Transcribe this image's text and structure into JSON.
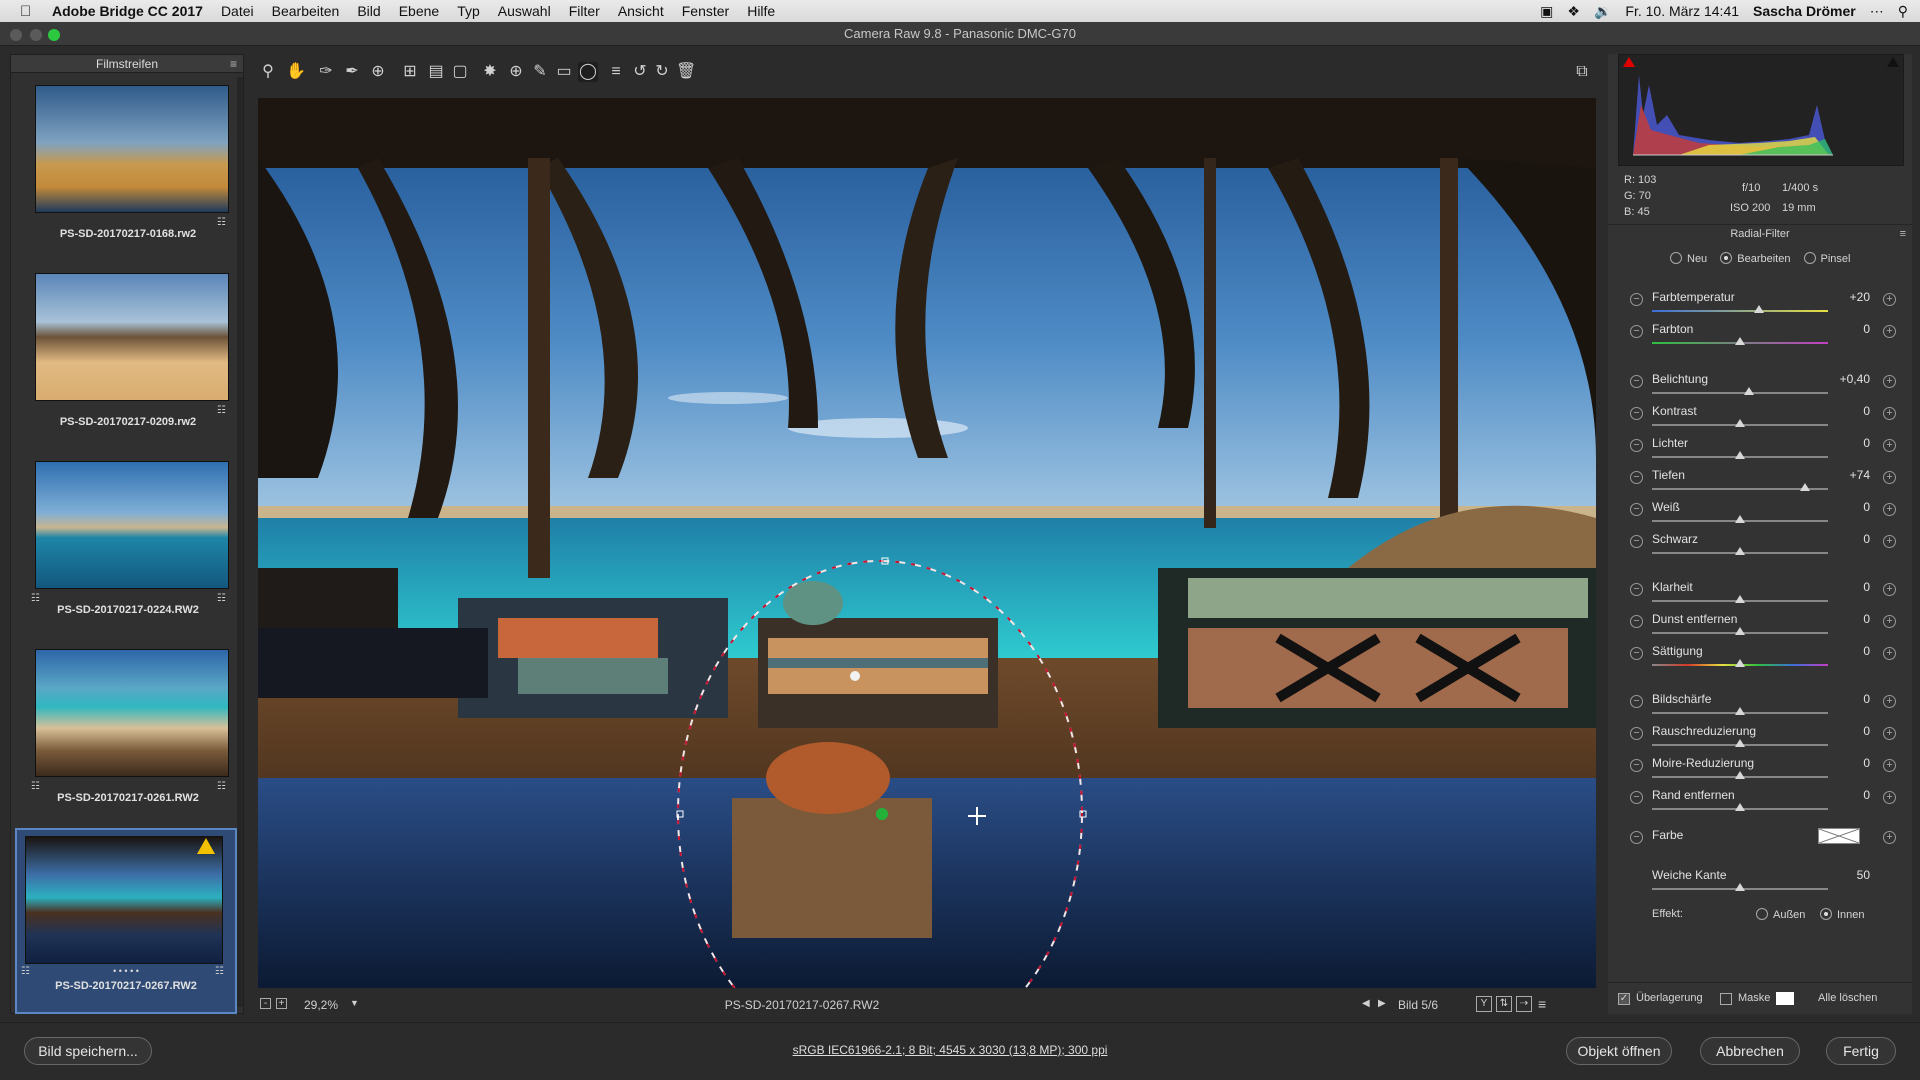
{
  "menubar": {
    "app": "Adobe Bridge CC 2017",
    "items": [
      "Datei",
      "Bearbeiten",
      "Bild",
      "Ebene",
      "Typ",
      "Auswahl",
      "Filter",
      "Ansicht",
      "Fenster",
      "Hilfe"
    ],
    "clock": "Fr. 10. März  14:41",
    "user": "Sascha Drömer"
  },
  "window": {
    "title": "Camera Raw 9.8 - Panasonic DMC-G70"
  },
  "filmstrip": {
    "title": "Filmstreifen",
    "items": [
      {
        "name": "PS-SD-20170217-0168.rw2"
      },
      {
        "name": "PS-SD-20170217-0209.rw2"
      },
      {
        "name": "PS-SD-20170217-0224.RW2"
      },
      {
        "name": "PS-SD-20170217-0261.RW2"
      },
      {
        "name": "PS-SD-20170217-0267.RW2",
        "dots": "• • • • •"
      }
    ]
  },
  "toolbar": {
    "tools": [
      "zoom-tool",
      "hand-tool",
      "white-balance-tool",
      "color-sampler-tool",
      "targeted-adjustment-tool",
      "crop-tool",
      "straighten-tool",
      "transform-tool",
      "spot-removal-tool",
      "red-eye-tool",
      "adjustment-brush-tool",
      "graduated-filter-tool",
      "radial-filter-tool",
      "preferences-tool",
      "rotate-left-tool",
      "rotate-right-tool",
      "trash-tool"
    ]
  },
  "image": {
    "filename": "PS-SD-20170217-0267.RW2",
    "zoom": "29,2%",
    "counter": "Bild 5/6"
  },
  "histogram": {
    "r": "R:  103",
    "g": "G:    70",
    "b": "B:    45",
    "aperture": "f/10",
    "shutter": "1/400 s",
    "iso": "ISO 200",
    "focal": "19 mm"
  },
  "panel": {
    "title": "Radial-Filter",
    "mode": {
      "neu": "Neu",
      "bearbeiten": "Bearbeiten",
      "pinsel": "Pinsel",
      "selected": "Bearbeiten"
    },
    "sliders": [
      {
        "label": "Farbtemperatur",
        "value": "+20",
        "pos": 0.61
      },
      {
        "label": "Farbton",
        "value": "0",
        "pos": 0.5
      },
      {
        "label": "Belichtung",
        "value": "+0,40",
        "pos": 0.55
      },
      {
        "label": "Kontrast",
        "value": "0",
        "pos": 0.5
      },
      {
        "label": "Lichter",
        "value": "0",
        "pos": 0.5
      },
      {
        "label": "Tiefen",
        "value": "+74",
        "pos": 0.87
      },
      {
        "label": "Weiß",
        "value": "0",
        "pos": 0.5
      },
      {
        "label": "Schwarz",
        "value": "0",
        "pos": 0.5
      },
      {
        "label": "Klarheit",
        "value": "0",
        "pos": 0.5
      },
      {
        "label": "Dunst entfernen",
        "value": "0",
        "pos": 0.5
      },
      {
        "label": "Sättigung",
        "value": "0",
        "pos": 0.5
      },
      {
        "label": "Bildschärfe",
        "value": "0",
        "pos": 0.5
      },
      {
        "label": "Rauschreduzierung",
        "value": "0",
        "pos": 0.5
      },
      {
        "label": "Moire-Reduzierung",
        "value": "0",
        "pos": 0.5
      },
      {
        "label": "Rand entfernen",
        "value": "0",
        "pos": 0.5
      }
    ],
    "farbe": "Farbe",
    "feather": {
      "label": "Weiche Kante",
      "value": "50",
      "pos": 0.5
    },
    "effekt": {
      "label": "Effekt:",
      "aussen": "Außen",
      "innen": "Innen",
      "selected": "Innen"
    },
    "overlay": "Überlagerung",
    "maske": "Maske",
    "clear_all": "Alle löschen"
  },
  "bottom": {
    "save": "Bild speichern...",
    "info": "sRGB IEC61966-2.1; 8 Bit; 4545 x 3030 (13,8 MP); 300 ppi",
    "open": "Objekt öffnen",
    "cancel": "Abbrechen",
    "done": "Fertig"
  }
}
